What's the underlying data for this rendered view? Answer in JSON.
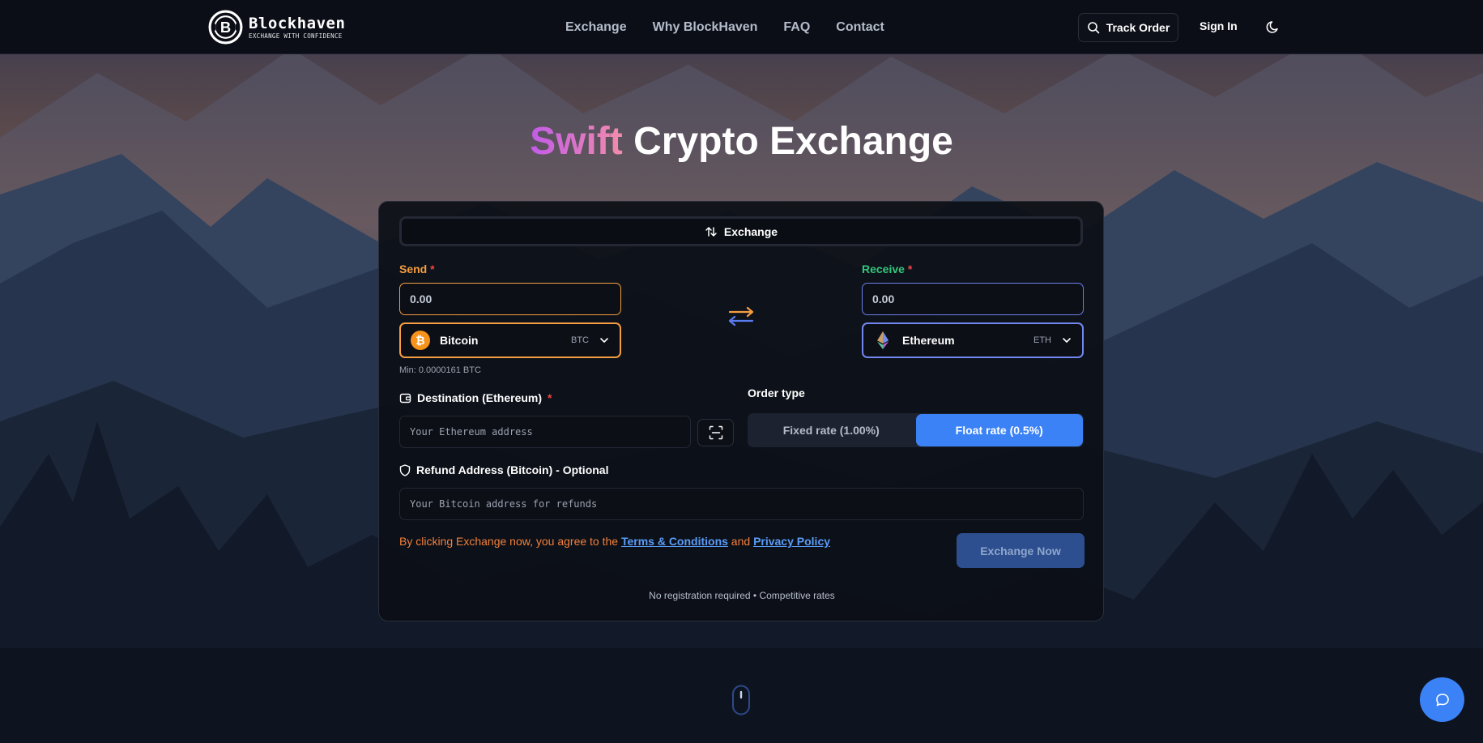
{
  "header": {
    "logo_name": "Blockhaven",
    "logo_tagline": "EXCHANGE WITH CONFIDENCE",
    "nav": [
      "Exchange",
      "Why BlockHaven",
      "FAQ",
      "Contact"
    ],
    "track_order": "Track Order",
    "sign_in": "Sign In",
    "theme_icon": "moon-icon"
  },
  "hero": {
    "title_accent": "Swift",
    "title_rest": "Crypto Exchange"
  },
  "card": {
    "tab_label": "Exchange",
    "send": {
      "label": "Send",
      "required_mark": "*",
      "amount_placeholder": "0.00",
      "coin_name": "Bitcoin",
      "coin_ticker": "BTC",
      "min_text": "Min: 0.0000161 BTC"
    },
    "receive": {
      "label": "Receive",
      "required_mark": "*",
      "amount_placeholder": "0.00",
      "coin_name": "Ethereum",
      "coin_ticker": "ETH"
    },
    "destination": {
      "label": "Destination (Ethereum)",
      "required_mark": "*",
      "placeholder": "Your Ethereum address"
    },
    "order_type": {
      "label": "Order type",
      "fixed": "Fixed rate (1.00%)",
      "float": "Float rate (0.5%)",
      "selected": "float"
    },
    "refund": {
      "label": "Refund Address (Bitcoin) - Optional",
      "placeholder": "Your Bitcoin address for refunds"
    },
    "terms": {
      "prefix": "By clicking Exchange now, you agree to the ",
      "terms_link": "Terms & Conditions",
      "and": " and ",
      "privacy_link": "Privacy Policy"
    },
    "submit": "Exchange Now",
    "footnote": "No registration required • Competitive rates"
  },
  "colors": {
    "accent_blue": "#3b82f6",
    "send_orange": "#f59e42",
    "receive_green": "#34c77b",
    "receive_border": "#6b7ee8"
  }
}
